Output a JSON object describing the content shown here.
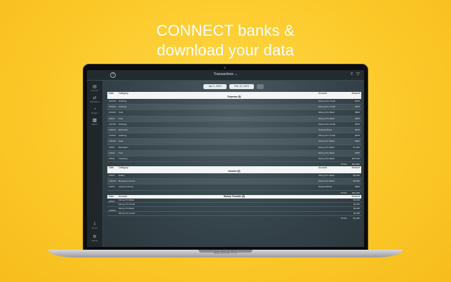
{
  "headline": {
    "line1": "CONNECT banks &",
    "line2": "download your data"
  },
  "laptop": {
    "brand": "MacBook Pro"
  },
  "app": {
    "title": "Transactions ⌄",
    "date_from": "Jan 1, 2021",
    "date_to": "Feb 12, 2021",
    "more": "···"
  },
  "sidebar": {
    "items": [
      {
        "icon": "accounts-icon",
        "label": "Accounts"
      },
      {
        "icon": "transactions-icon",
        "label": "Transactions"
      },
      {
        "icon": "budgets-icon",
        "label": "Budgets"
      },
      {
        "icon": "reports-icon",
        "label": "Reports"
      },
      {
        "icon": "imports-icon",
        "label": "Imports"
      },
      {
        "icon": "settings-icon",
        "label": "Settings"
      }
    ]
  },
  "columns": {
    "date": "Date",
    "category": "Category",
    "account": "Account",
    "amount": "Amount"
  },
  "expense": {
    "title": "Expense ($)",
    "rows": [
      {
        "date": "2/14/21",
        "category": "Clothing",
        "account": "Money Pro Credit",
        "amount": "$750"
      },
      {
        "date": "2/14/21",
        "category": "Clothing",
        "account": "Money Pro Credit",
        "amount": "$700"
      },
      {
        "date": "2/14/21",
        "category": "Cafe",
        "account": "Money Pro Bank",
        "amount": "$800"
      },
      {
        "date": "2/1/21",
        "category": "Fuel",
        "account": "Money Pro Bank",
        "amount": "$300"
      },
      {
        "date": "1/27/21",
        "category": "Clothing",
        "account": "Money Pro Credit",
        "amount": "$750"
      },
      {
        "date": "1/15/21",
        "category": "Electricity",
        "account": "National Bank",
        "amount": "$120"
      },
      {
        "date": "1/13/21",
        "category": "Clothing",
        "account": "Money Pro Credit",
        "amount": "$700"
      },
      {
        "date": "1/10/21",
        "category": "Cafe",
        "account": "Money Pro Bank",
        "amount": "$800"
      },
      {
        "date": "1/6/21",
        "category": "Education",
        "account": "Money Pro Bank",
        "amount": "$1,200"
      },
      {
        "date": "1/1/21",
        "category": "Fuel",
        "account": "Money Pro Bank",
        "amount": "$250"
      },
      {
        "date": "1/5/21",
        "category": "Traveling",
        "account": "Money Pro Bank",
        "amount": "$15,330"
      }
    ],
    "total_label": "TOTAL",
    "total": "$20,800"
  },
  "income": {
    "title": "Income ($)",
    "rows": [
      {
        "date": "2/1/21",
        "category": "Salary",
        "account": "Money Pro Bank",
        "amount": "$5,000"
      },
      {
        "date": "1/20/21",
        "category": "Business Income",
        "account": "Money Pro Bank",
        "amount": "$5,000"
      },
      {
        "date": "1/1/21",
        "category": "Interest Income",
        "account": "National Bank",
        "amount": "$400"
      }
    ],
    "total_label": "TOTAL",
    "total": "$10,400"
  },
  "transfer": {
    "title": "Money Transfer ($)",
    "account_col": "Account",
    "groups": [
      {
        "date": "2/6/21",
        "rows": [
          {
            "account": "Money Pro Bank",
            "amount": "$2,000"
          },
          {
            "account": "Money Pro Credit",
            "amount": "$2,000"
          }
        ]
      },
      {
        "date": "1/24/21",
        "rows": [
          {
            "account": "Money Pro Bank",
            "amount": "$2,000"
          },
          {
            "account": "Money Pro Credit",
            "amount": "$2,000"
          }
        ]
      }
    ],
    "total_label": "TOTAL",
    "total": "$4,000"
  }
}
